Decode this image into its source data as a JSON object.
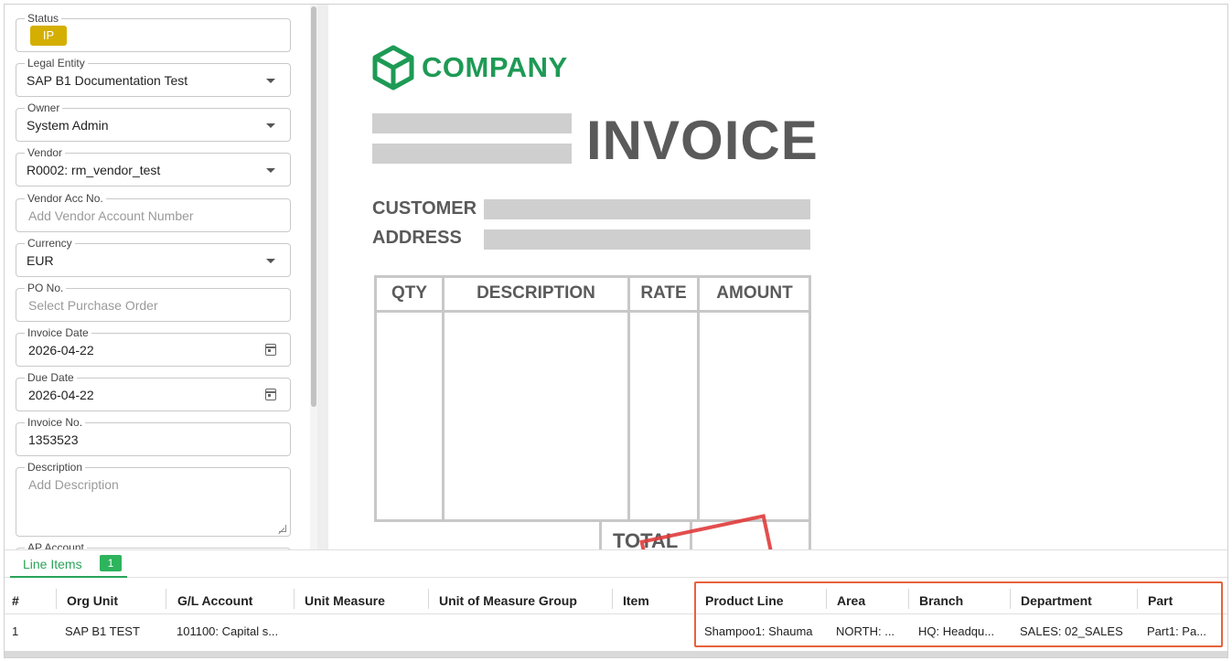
{
  "form": {
    "status": {
      "label": "Status",
      "value": "IP"
    },
    "legal_entity": {
      "label": "Legal Entity",
      "value": "SAP B1 Documentation Test"
    },
    "owner": {
      "label": "Owner",
      "value": "System Admin"
    },
    "vendor": {
      "label": "Vendor",
      "value": "R0002: rm_vendor_test"
    },
    "vendor_acc": {
      "label": "Vendor Acc No.",
      "placeholder": "Add Vendor Account Number"
    },
    "currency": {
      "label": "Currency",
      "value": "EUR"
    },
    "po_no": {
      "label": "PO No.",
      "placeholder": "Select Purchase Order"
    },
    "invoice_date": {
      "label": "Invoice Date",
      "value": "2026-04-22"
    },
    "due_date": {
      "label": "Due Date",
      "value": "2026-04-22"
    },
    "invoice_no": {
      "label": "Invoice No.",
      "value": "1353523"
    },
    "description": {
      "label": "Description",
      "placeholder": "Add Description"
    },
    "ap_account": {
      "label": "AP Account"
    }
  },
  "preview": {
    "company": "COMPANY",
    "title": "INVOICE",
    "customer_label": "CUSTOMER",
    "address_label": "ADDRESS",
    "headers": [
      "QTY",
      "DESCRIPTION",
      "RATE",
      "AMOUNT"
    ],
    "total_label": "TOTAL"
  },
  "line_items": {
    "tab_label": "Line Items",
    "tab_count": "1",
    "columns": [
      "#",
      "Org Unit",
      "G/L Account",
      "Unit Measure",
      "Unit of Measure Group",
      "Item",
      "Product Line",
      "Area",
      "Branch",
      "Department",
      "Part"
    ],
    "rows": [
      [
        "1",
        "SAP B1 TEST",
        "101100: Capital s...",
        "",
        "",
        "",
        "Shampoo1: Shauma",
        "NORTH: ...",
        "HQ: Headqu...",
        "SALES: 02_SALES",
        "Part1: Pa..."
      ]
    ]
  },
  "colors": {
    "accent": "#2aa35a",
    "status_badge": "#d4af00",
    "highlight": "#e8613a",
    "logo": "#1e9a55"
  }
}
